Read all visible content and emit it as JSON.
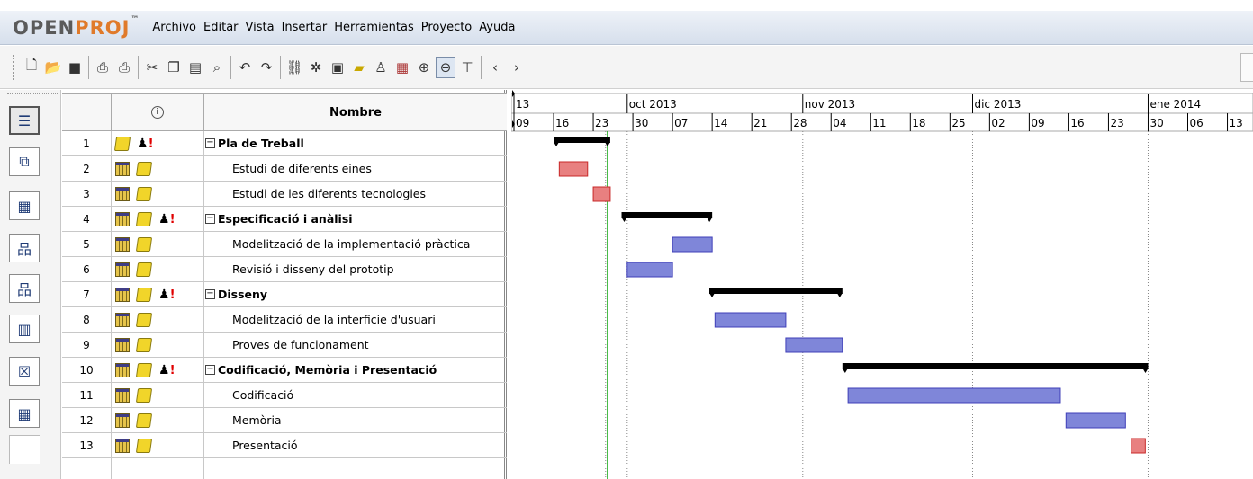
{
  "app": {
    "logo_open": "OPEN",
    "logo_proj": "PROJ",
    "logo_tm": "™"
  },
  "menu": [
    "Archivo",
    "Editar",
    "Vista",
    "Insertar",
    "Herramientas",
    "Proyecto",
    "Ayuda"
  ],
  "toolbar": {
    "buttons": [
      "new-icon",
      "open-icon",
      "save-icon",
      "print-icon",
      "print-preview-icon",
      "cut-icon",
      "copy-icon",
      "paste-icon",
      "find-icon",
      "undo-icon",
      "redo-icon",
      "link-icon",
      "unlink-icon",
      "task-info-icon",
      "notes-icon",
      "resource-icon",
      "assign-icon",
      "zoom-in-icon",
      "zoom-out-icon",
      "filter-icon",
      "scroll-left-icon",
      "scroll-right-icon"
    ],
    "selected": "zoom-out-icon"
  },
  "views": [
    "gantt-view",
    "network-view",
    "resource-usage-view",
    "wbs-view",
    "rbs-view",
    "task-usage-view",
    "report-view",
    "resource-view-2"
  ],
  "table": {
    "header_name": "Nombre",
    "header_info_icon": "info-icon",
    "rows": [
      {
        "id": "1",
        "name": "Pla de Treball",
        "summary": true,
        "indicators": [
          "note",
          "resource-alert"
        ]
      },
      {
        "id": "2",
        "name": "Estudi de diferents eines",
        "summary": false,
        "indicators": [
          "calendar",
          "note"
        ]
      },
      {
        "id": "3",
        "name": "Estudi de les diferents tecnologies",
        "summary": false,
        "indicators": [
          "calendar",
          "note"
        ]
      },
      {
        "id": "4",
        "name": "Especificació i anàlisi",
        "summary": true,
        "indicators": [
          "calendar",
          "note",
          "resource-alert"
        ]
      },
      {
        "id": "5",
        "name": "Modelització de la implementació pràctica",
        "summary": false,
        "indicators": [
          "calendar",
          "note"
        ]
      },
      {
        "id": "6",
        "name": "Revisió i disseny del prototip",
        "summary": false,
        "indicators": [
          "calendar",
          "note"
        ]
      },
      {
        "id": "7",
        "name": "Disseny",
        "summary": true,
        "indicators": [
          "calendar",
          "note",
          "resource-alert"
        ]
      },
      {
        "id": "8",
        "name": "Modelització de la interficie d'usuari",
        "summary": false,
        "indicators": [
          "calendar",
          "note"
        ]
      },
      {
        "id": "9",
        "name": "Proves de funcionament",
        "summary": false,
        "indicators": [
          "calendar",
          "note"
        ]
      },
      {
        "id": "10",
        "name": "Codificació, Memòria i Presentació",
        "summary": true,
        "indicators": [
          "calendar",
          "note",
          "resource-alert"
        ]
      },
      {
        "id": "11",
        "name": "Codificació",
        "summary": false,
        "indicators": [
          "calendar",
          "note"
        ]
      },
      {
        "id": "12",
        "name": "Memòria",
        "summary": false,
        "indicators": [
          "calendar",
          "note"
        ]
      },
      {
        "id": "13",
        "name": "Presentació",
        "summary": false,
        "indicators": [
          "calendar",
          "note"
        ]
      }
    ]
  },
  "gantt": {
    "months": [
      {
        "label": "13",
        "day": 0
      },
      {
        "label": "oct 2013",
        "day": 20
      },
      {
        "label": "nov 2013",
        "day": 51
      },
      {
        "label": "dic 2013",
        "day": 81
      },
      {
        "label": "ene 2014",
        "day": 112
      }
    ],
    "weeks": [
      "09",
      "16",
      "23",
      "30",
      "07",
      "14",
      "21",
      "28",
      "04",
      "11",
      "18",
      "25",
      "02",
      "09",
      "16",
      "23",
      "30",
      "06",
      "13"
    ],
    "today_day": 16.5,
    "bars": [
      {
        "row": 1,
        "type": "summary",
        "start": 7,
        "end": 17
      },
      {
        "row": 2,
        "type": "critical",
        "start": 8,
        "end": 13
      },
      {
        "row": 3,
        "type": "critical",
        "start": 14,
        "end": 17
      },
      {
        "row": 4,
        "type": "summary",
        "start": 19,
        "end": 35
      },
      {
        "row": 5,
        "type": "task",
        "start": 28,
        "end": 35
      },
      {
        "row": 6,
        "type": "task",
        "start": 20,
        "end": 28
      },
      {
        "row": 7,
        "type": "summary",
        "start": 34.5,
        "end": 58
      },
      {
        "row": 8,
        "type": "task",
        "start": 35.5,
        "end": 48
      },
      {
        "row": 9,
        "type": "task",
        "start": 48,
        "end": 58
      },
      {
        "row": 10,
        "type": "summary",
        "start": 58,
        "end": 112
      },
      {
        "row": 11,
        "type": "task",
        "start": 59,
        "end": 96.5
      },
      {
        "row": 12,
        "type": "task",
        "start": 97.5,
        "end": 108
      },
      {
        "row": 13,
        "type": "critical",
        "start": 109,
        "end": 111.5
      }
    ],
    "colors": {
      "task": "#3f3fb8",
      "task_fill": "#7f86d9",
      "critical": "#c82828",
      "critical_fill": "#e88080",
      "summary": "#000000",
      "today": "#00a000"
    }
  }
}
